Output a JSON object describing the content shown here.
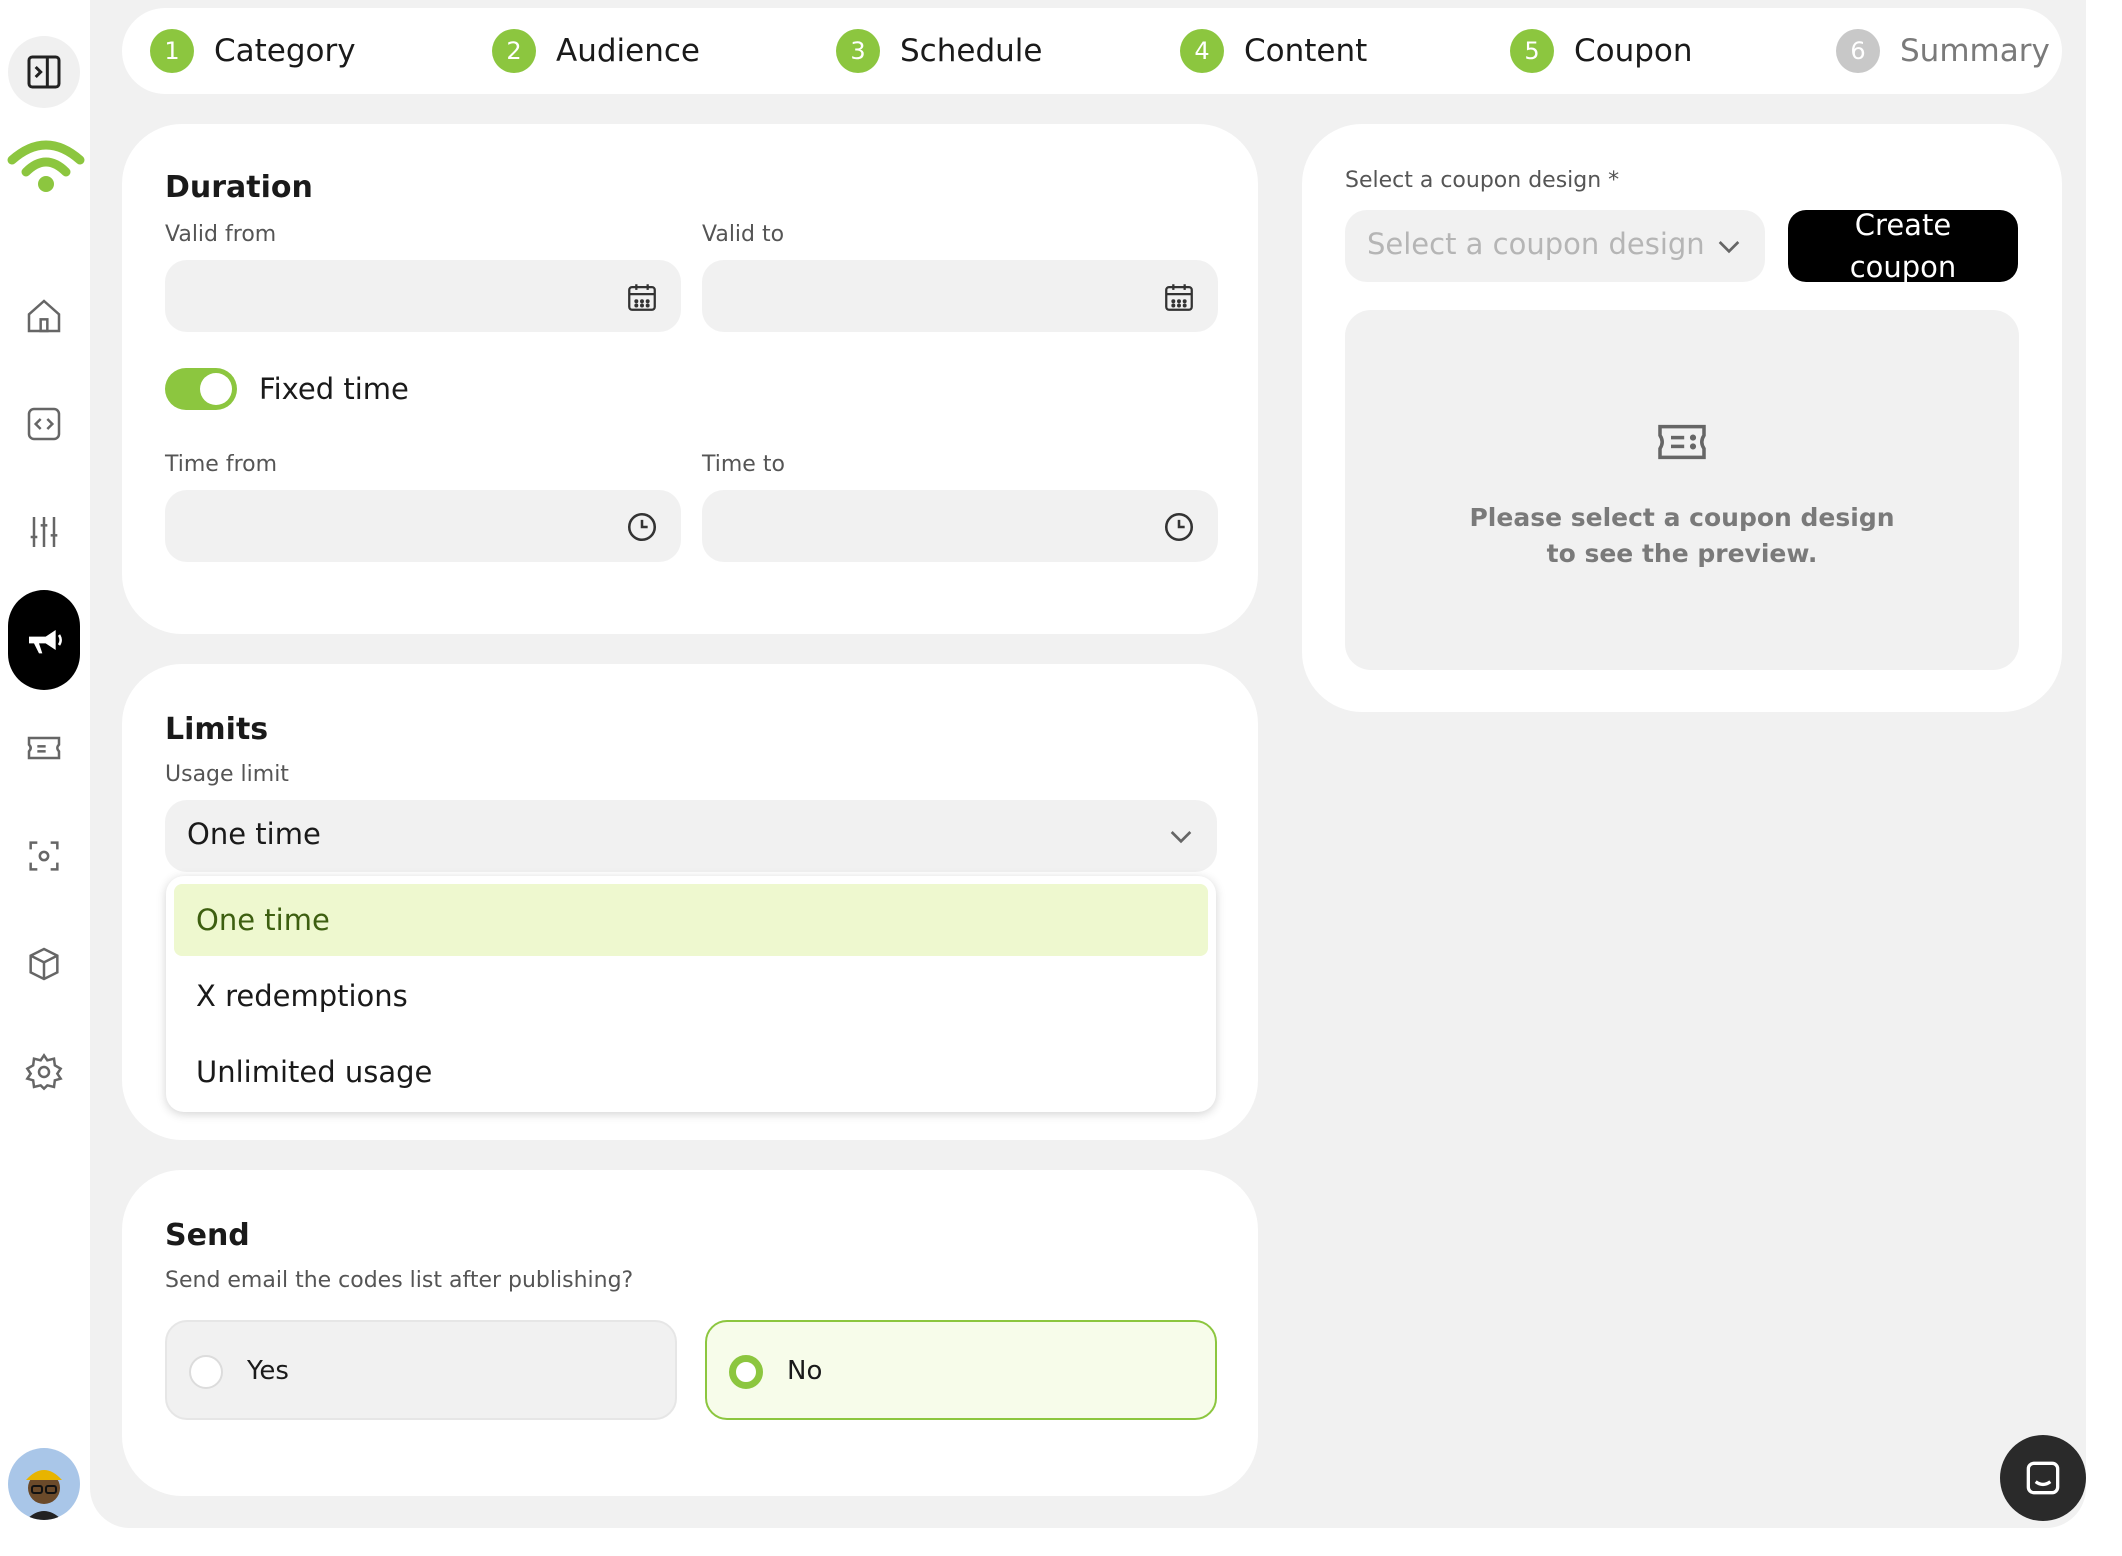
{
  "stepper": [
    {
      "num": "1",
      "label": "Category"
    },
    {
      "num": "2",
      "label": "Audience"
    },
    {
      "num": "3",
      "label": "Schedule"
    },
    {
      "num": "4",
      "label": "Content"
    },
    {
      "num": "5",
      "label": "Coupon"
    },
    {
      "num": "6",
      "label": "Summary"
    }
  ],
  "duration": {
    "title": "Duration",
    "valid_from_label": "Valid from",
    "valid_to_label": "Valid to",
    "fixed_time_label": "Fixed time",
    "time_from_label": "Time from",
    "time_to_label": "Time to"
  },
  "limits": {
    "title": "Limits",
    "usage_limit_label": "Usage limit",
    "selected": "One time",
    "options": [
      "One time",
      "X redemptions",
      "Unlimited usage"
    ]
  },
  "send": {
    "title": "Send",
    "question": "Send email the codes list after publishing?",
    "yes_label": "Yes",
    "no_label": "No"
  },
  "coupon": {
    "select_label": "Select a coupon design *",
    "select_placeholder": "Select a coupon design",
    "create_line1": "Create",
    "create_line2": "coupon",
    "preview_line1": "Please select a coupon design",
    "preview_line2": "to see the preview."
  },
  "colors": {
    "accent": "#8cc63f",
    "background": "#f1f1f1"
  }
}
